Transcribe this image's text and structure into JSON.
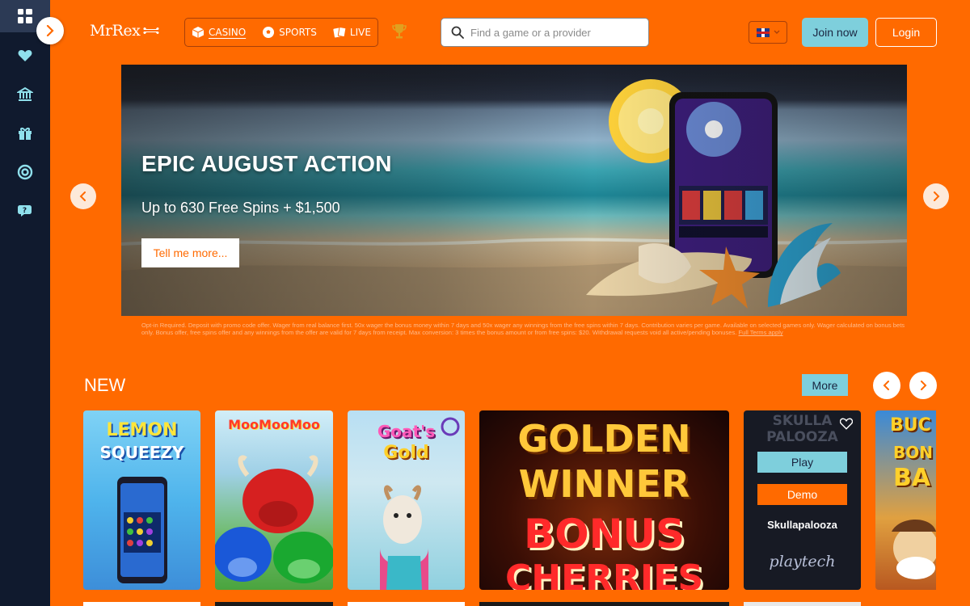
{
  "header": {
    "logo_text": "MrRex",
    "nav": [
      {
        "label": "CASINO",
        "icon": "dice-icon",
        "active": true
      },
      {
        "label": "SPORTS",
        "icon": "football-icon",
        "active": false
      },
      {
        "label": "LIVE",
        "icon": "cards-icon",
        "active": false
      }
    ],
    "search_placeholder": "Find a game or a provider",
    "language": "en-GB",
    "join_label": "Join now",
    "login_label": "Login"
  },
  "sidebar": {
    "items": [
      "grid-icon",
      "heart-icon",
      "bank-icon",
      "gift-icon",
      "lifebuoy-icon",
      "support-icon"
    ]
  },
  "banner": {
    "title": "EPIC AUGUST ACTION",
    "subtitle": "Up to 630 Free Spins + $1,500",
    "button_label": "Tell me more..."
  },
  "terms": {
    "text": "Opt-in Required. Deposit with promo code offer. Wager from real balance first. 50x wager the bonus money within 7 days and 50x wager any winnings from the free spins within 7 days. Contribution varies per game. Available on selected games only. Wager calculated on bonus bets only. Bonus offer, free spins offer and any winnings from the offer are valid for 7 days from receipt. Max conversion: 3 times the bonus amount or from free spins: $20. Withdrawal requests void all active/pending bonuses.",
    "link_label": "Full Terms apply"
  },
  "new_section": {
    "title": "NEW",
    "more_label": "More",
    "games": [
      {
        "title_line1": "LEMON",
        "title_line2": "SQUEEZY"
      },
      {
        "title_line1": "MooMooMoo",
        "title_line2": ""
      },
      {
        "title_line1": "Goat's",
        "title_line2": "Gold"
      },
      {
        "title_line1": "GOLDEN",
        "title_line2": "WINNER",
        "title_line3": "BONUS",
        "title_line4": "CHERRIES"
      },
      {
        "name": "Skullapalooza",
        "banner_text": "SKULLA PALOOZA",
        "provider": "playtech",
        "play_label": "Play",
        "demo_label": "Demo"
      },
      {
        "title_line1": "BUC",
        "title_line2": "BON",
        "title_line3": "BA"
      }
    ]
  },
  "colors": {
    "page_bg": "#ff6a00",
    "sidebar_bg": "#101a2e",
    "accent_teal": "#7ecfdc"
  }
}
